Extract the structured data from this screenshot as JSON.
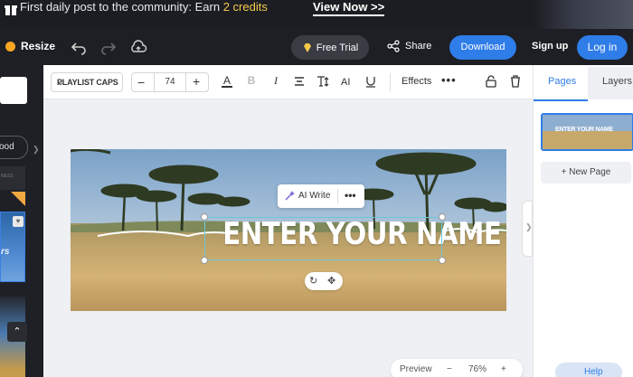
{
  "promo": {
    "text_prefix": "First daily post to the community: Earn ",
    "credits": "2 credits",
    "cta": "View Now >>"
  },
  "topnav": {
    "resize_label": "Resize",
    "free_trial_label": "Free Trial",
    "share_label": "Share",
    "download_label": "Download",
    "signup_label": "Sign up",
    "login_label": "Log in"
  },
  "left_panel": {
    "pill_label": "ood",
    "thumb_small_text": "NESS",
    "thumb_italic": "rs"
  },
  "toolbar": {
    "font_name": "PLAYLIST CAPS",
    "font_size": "74",
    "effects_label": "Effects"
  },
  "canvas": {
    "headline": "ENTER YOUR NAME",
    "ai_write_label": "AI Write"
  },
  "zoom": {
    "preview_label": "Preview",
    "zoom_value": "76%"
  },
  "right_panel": {
    "tab_pages": "Pages",
    "tab_layers": "Layers",
    "thumb_text": "ENTER YOUR NAME",
    "new_page_label": "+ New Page",
    "help_label": "Help"
  },
  "colors": {
    "accent": "#2f7de8",
    "credits": "#f6c94b",
    "nav_bg": "#1d1f25",
    "selection": "#6cc6d8"
  }
}
